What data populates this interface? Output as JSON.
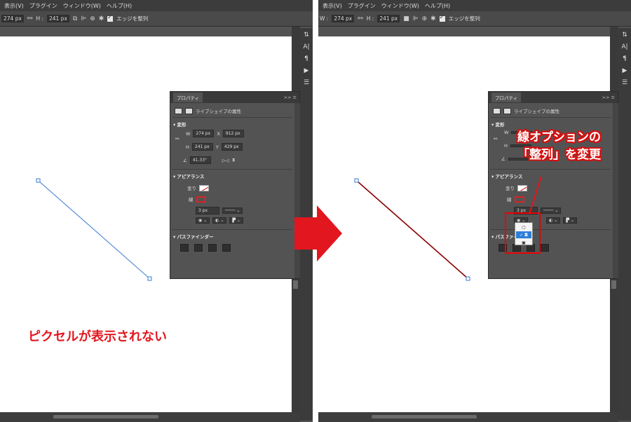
{
  "menu": {
    "left": [
      "表示(V)",
      "プラグイン",
      "ウィンドウ(W)",
      "ヘルプ(H)"
    ],
    "right": [
      "表示(V)",
      "プラグイン",
      "ウィンドウ(W)",
      "ヘルプ(H)"
    ]
  },
  "options": {
    "w_value_left": "274 px",
    "h_label": "H :",
    "h_value": "241 px",
    "w_label_right": "W :",
    "w_value_right": "274 px",
    "align_edges": "エッジを整列"
  },
  "panel": {
    "tab": "プロパティ",
    "collapse": ">>",
    "menu": "≡",
    "subtitle": "ライブシェイプの属性",
    "transform_title": "変形",
    "w_label": "W",
    "w_value": "274 px",
    "x_label": "X",
    "x_value": "912 px",
    "h_label": "H",
    "h_value": "241 px",
    "y_label": "Y",
    "y_value": "429 px",
    "angle_value": "41.33°",
    "appearance_title": "アピアランス",
    "fill_label": "塗り",
    "stroke_label": "線",
    "stroke_width": "3 px",
    "pathfinder_title": "パスファインダー"
  },
  "annotations": {
    "left_note": "ピクセルが表示されない",
    "right_note_line1": "線オプションの",
    "right_note_line2": "「整列」を変更"
  },
  "colors": {
    "annotation_red": "#e2161e",
    "selected_line": "#3a7bd5",
    "stroke_line": "#8b0000"
  }
}
